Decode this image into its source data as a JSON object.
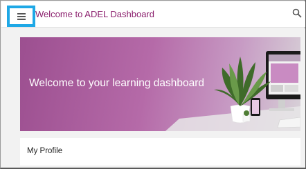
{
  "header": {
    "menu_icon": "hamburger-menu-icon",
    "title": "Welcome to ADEL Dashboard",
    "search_icon": "search-icon"
  },
  "banner": {
    "text": "Welcome to your learning dashboard"
  },
  "profile": {
    "label": "My Profile"
  },
  "colors": {
    "brand": "#8b1f6d",
    "highlight": "#1ea8e6",
    "banner": "#9c4f90"
  }
}
